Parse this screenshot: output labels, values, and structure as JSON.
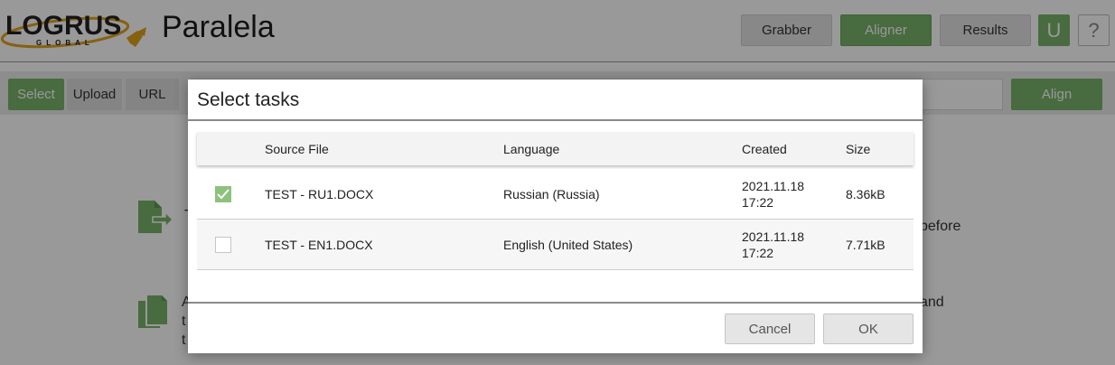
{
  "app": {
    "logo_text": "LOGRUS",
    "logo_sub": "GLOBAL",
    "title": "Paralela"
  },
  "nav": {
    "grabber": "Grabber",
    "aligner": "Aligner",
    "results": "Results",
    "user_initial": "U",
    "help": "?"
  },
  "toolbar": {
    "select": "Select",
    "upload": "Upload",
    "url": "URL",
    "align": "Align"
  },
  "background": {
    "line1_fragment": "before",
    "line2_fragment": "and",
    "line2_left_a": "A",
    "line2_left_b": "t",
    "line2_left_c": "t",
    "line1_left": "T"
  },
  "modal": {
    "title": "Select tasks",
    "columns": {
      "file": "Source File",
      "language": "Language",
      "created": "Created",
      "size": "Size"
    },
    "rows": [
      {
        "checked": true,
        "file": "TEST - RU1.DOCX",
        "language": "Russian (Russia)",
        "created_date": "2021.11.18",
        "created_time": "17:22",
        "size": "8.36kB"
      },
      {
        "checked": false,
        "file": "TEST - EN1.DOCX",
        "language": "English (United States)",
        "created_date": "2021.11.18",
        "created_time": "17:22",
        "size": "7.71kB"
      }
    ],
    "cancel": "Cancel",
    "ok": "OK"
  },
  "colors": {
    "accent_green": "#78b26a",
    "check_green": "#8cc27b",
    "logo_gold": "#e0a21b"
  }
}
